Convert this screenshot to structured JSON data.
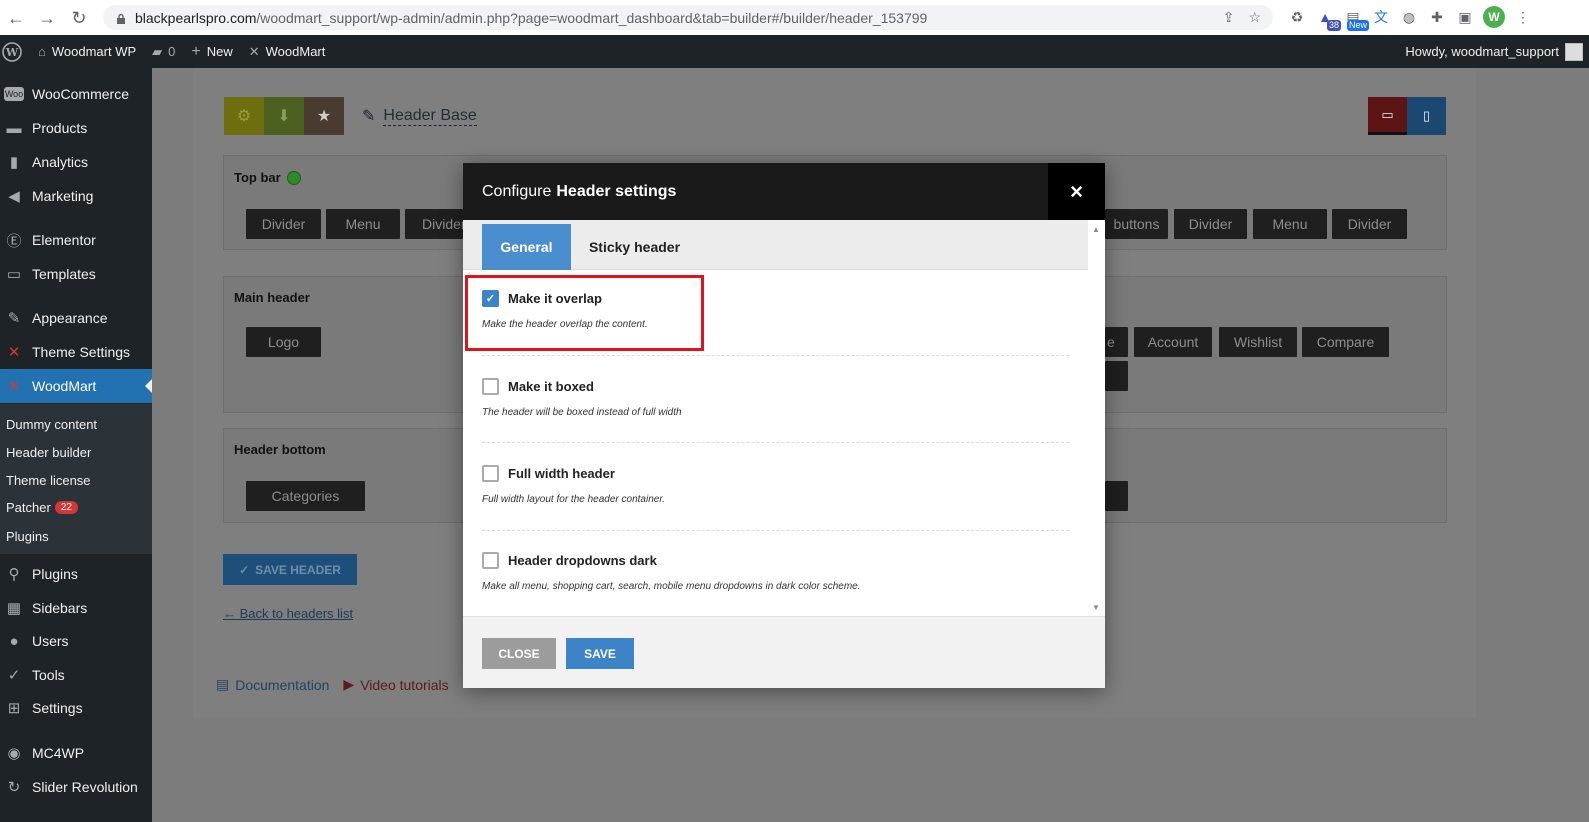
{
  "browser": {
    "url_host": "blackpearlspro.com",
    "url_rest": "/woodmart_support/wp-admin/admin.php?page=woodmart_dashboard&tab=builder#/builder/header_153799",
    "ext_badge_count": "38",
    "ext_badge_new": "New",
    "profile_initial": "W"
  },
  "adminbar": {
    "site_name": "Woodmart WP",
    "comments_count": "0",
    "new_label": "New",
    "woodmart_label": "WoodMart",
    "howdy": "Howdy, woodmart_support"
  },
  "sidebar": {
    "items": [
      {
        "label": "WooCommerce",
        "icon": "woo-icon"
      },
      {
        "label": "Products",
        "icon": "archive-icon"
      },
      {
        "label": "Analytics",
        "icon": "bar-chart-icon"
      },
      {
        "label": "Marketing",
        "icon": "megaphone-icon"
      },
      {
        "label": "Elementor",
        "icon": "elementor-icon"
      },
      {
        "label": "Templates",
        "icon": "folder-icon"
      },
      {
        "label": "Appearance",
        "icon": "paintbrush-icon"
      },
      {
        "label": "Theme Settings",
        "icon": "woodmart-icon"
      },
      {
        "label": "WoodMart",
        "icon": "woodmart-icon"
      },
      {
        "label": "Plugins",
        "icon": "plug-icon"
      },
      {
        "label": "Sidebars",
        "icon": "grid-icon"
      },
      {
        "label": "Users",
        "icon": "user-icon"
      },
      {
        "label": "Tools",
        "icon": "wrench-icon"
      },
      {
        "label": "Settings",
        "icon": "sliders-icon"
      },
      {
        "label": "MC4WP",
        "icon": "mc4wp-icon"
      },
      {
        "label": "Slider Revolution",
        "icon": "refresh-icon"
      }
    ],
    "submenu": [
      {
        "label": "Dummy content"
      },
      {
        "label": "Header builder"
      },
      {
        "label": "Theme license"
      },
      {
        "label": "Patcher",
        "badge": "22"
      },
      {
        "label": "Plugins"
      }
    ]
  },
  "builder": {
    "header_name": "Header Base",
    "top_bar_label": "Top bar",
    "main_header_label": "Main header",
    "header_bottom_label": "Header bottom",
    "top_bar_left": [
      "Divider",
      "Menu",
      "Divider"
    ],
    "top_bar_right": [
      "buttons",
      "Divider",
      "Menu",
      "Divider"
    ],
    "main_left": [
      "Logo"
    ],
    "main_right": [
      "e",
      "Account",
      "Wishlist",
      "Compare"
    ],
    "bottom_left": [
      "Categories"
    ],
    "save_header": "SAVE HEADER",
    "back_link": "← Back to headers list",
    "footer_documentation": "Documentation",
    "footer_video": "Video tutorials"
  },
  "modal": {
    "title_prefix": "Configure",
    "title_bold": "Header settings",
    "close_x": "×",
    "tabs": [
      "General",
      "Sticky header"
    ],
    "options": [
      {
        "label": "Make it overlap",
        "desc": "Make the header overlap the content.",
        "checked": true
      },
      {
        "label": "Make it boxed",
        "desc": "The header will be boxed instead of full width",
        "checked": false
      },
      {
        "label": "Full width header",
        "desc": "Full width layout for the header container.",
        "checked": false
      },
      {
        "label": "Header dropdowns dark",
        "desc": "Make all menu, shopping cart, search, mobile menu dropdowns in dark color scheme.",
        "checked": false
      }
    ],
    "close_button": "CLOSE",
    "save_button": "SAVE"
  },
  "colors": {
    "accent": "#4a8ed0",
    "highlight": "#e1141d",
    "wp_admin_bg": "#1d2327"
  }
}
